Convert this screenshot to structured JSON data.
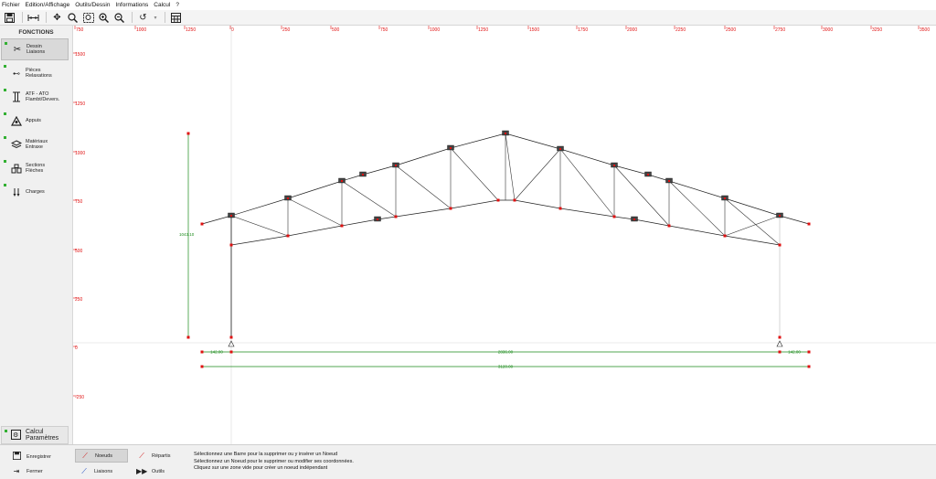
{
  "menu": [
    "Fichier",
    "Edition/Affichage",
    "Outils/Dessin",
    "Informations",
    "Calcul",
    "?"
  ],
  "left_panel": {
    "title": "FONCTIONS",
    "items": [
      {
        "label1": "Dessin",
        "label2": "Liaisons",
        "icon": "scissors-icon",
        "active": true
      },
      {
        "label1": "Pièces",
        "label2": "Relaxations",
        "icon": "pieces-icon",
        "active": false
      },
      {
        "label1": "ATF - ATO",
        "label2": "Flambt/Devers.",
        "icon": "column-icon",
        "active": false
      },
      {
        "label1": "Appuis",
        "label2": "",
        "icon": "support-icon",
        "active": false
      },
      {
        "label1": "Matériaux",
        "label2": "Entraxe",
        "icon": "layers-icon",
        "active": false
      },
      {
        "label1": "Sections",
        "label2": "Flèches",
        "icon": "sections-icon",
        "active": false
      },
      {
        "label1": "Charges",
        "label2": "",
        "icon": "loads-icon",
        "active": false
      }
    ],
    "calc": {
      "label1": "Calcul",
      "label2": "Paramètres"
    }
  },
  "ruler": {
    "x_ticks": [
      "750",
      "1000",
      "1250",
      "0",
      "250",
      "500",
      "750",
      "1000",
      "1250",
      "1500",
      "1750",
      "2000",
      "2250",
      "2500",
      "2750",
      "3000",
      "3250",
      "3500"
    ],
    "y_ticks": [
      "1500",
      "1250",
      "1000",
      "750",
      "500",
      "250",
      "0",
      "-250"
    ]
  },
  "dimensions": {
    "height": "1043.10",
    "left_overhang": "142.00",
    "span": "2836.00",
    "right_overhang": "142.00",
    "total": "3120.00"
  },
  "bottom": {
    "enregistrer": "Enregistrer",
    "fermer": "Fermer",
    "noeuds": "Noeuds",
    "liaisons": "Liaisons",
    "repartis": "Répartis",
    "outils": "Outils"
  },
  "hint": [
    "Sélectionnez une Barre pour la supprimer ou y insérer un Noeud",
    "Sélectionnez un Noeud pour le supprimer ou modifier ses coordonnées.",
    "Cliquez sur une zone vide pour créer un noeud indépendant"
  ],
  "colors": {
    "node": "#e01010",
    "ruler": "#e01010",
    "dimension": "#1a8a1a",
    "member": "#222222"
  }
}
